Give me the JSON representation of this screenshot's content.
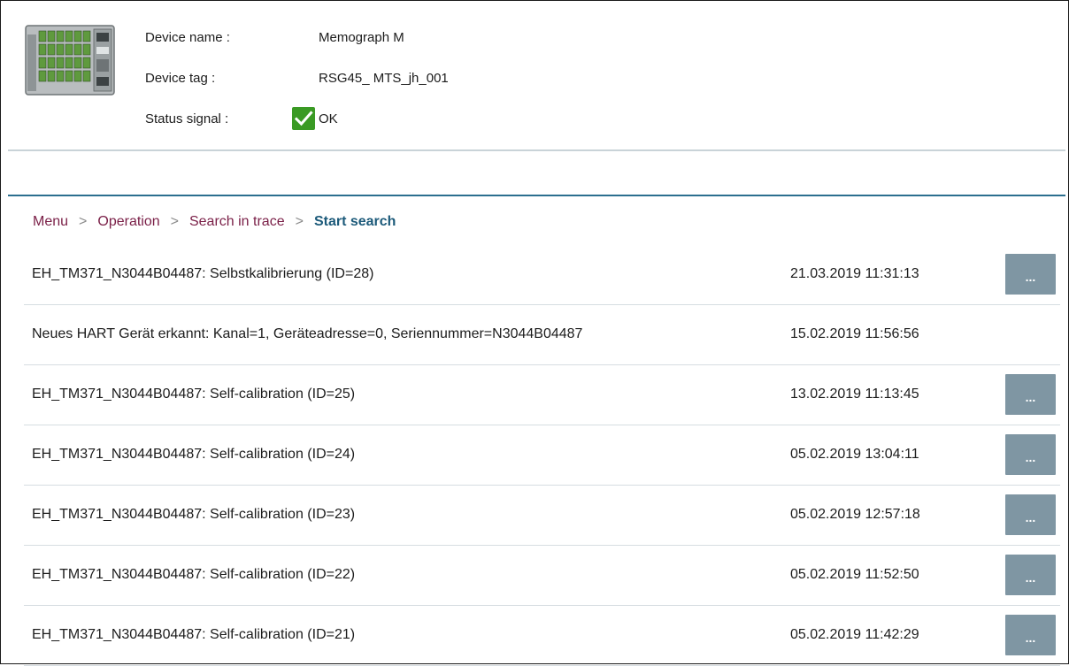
{
  "device": {
    "name_label": "Device name :",
    "name_value": "Memograph M",
    "tag_label": "Device tag :",
    "tag_value": "RSG45_ MTS_jh_001",
    "status_label": "Status signal :",
    "status_value": "OK",
    "status_color": "#3a9a24",
    "image_icon": "device-image"
  },
  "breadcrumb": {
    "items": [
      "Menu",
      "Operation",
      "Search in trace"
    ],
    "separator": ">",
    "current": "Start search"
  },
  "entries": [
    {
      "text": "EH_TM371_N3044B04487: Selbstkalibrierung (ID=28)",
      "timestamp": "21.03.2019 11:31:13",
      "button": "..."
    },
    {
      "text": "Neues HART Gerät erkannt: Kanal=1, Geräteadresse=0, Seriennummer=N3044B04487",
      "timestamp": "15.02.2019 11:56:56",
      "button": ""
    },
    {
      "text": "EH_TM371_N3044B04487: Self-calibration (ID=25)",
      "timestamp": "13.02.2019 11:13:45",
      "button": "..."
    },
    {
      "text": "EH_TM371_N3044B04487: Self-calibration (ID=24)",
      "timestamp": "05.02.2019 13:04:11",
      "button": "..."
    },
    {
      "text": "EH_TM371_N3044B04487: Self-calibration (ID=23)",
      "timestamp": "05.02.2019 12:57:18",
      "button": "..."
    },
    {
      "text": "EH_TM371_N3044B04487: Self-calibration (ID=22)",
      "timestamp": "05.02.2019 11:52:50",
      "button": "..."
    },
    {
      "text": "EH_TM371_N3044B04487: Self-calibration (ID=21)",
      "timestamp": "05.02.2019 11:42:29",
      "button": "..."
    }
  ],
  "colors": {
    "breadcrumb_link": "#7a1f47",
    "breadcrumb_current": "#1c5a7a",
    "button_bg": "#7f96a3",
    "accent_line": "#2b6f8f"
  }
}
